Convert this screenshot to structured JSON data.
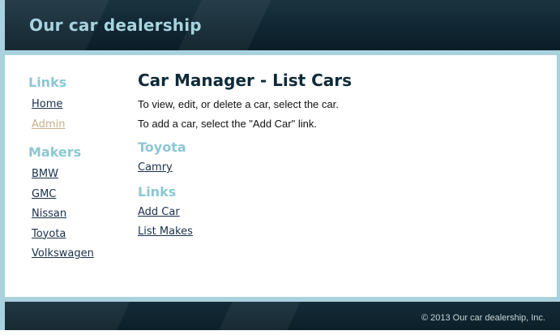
{
  "header": {
    "title": "Our car dealership"
  },
  "sidebar": {
    "links_heading": "Links",
    "links": [
      {
        "label": "Home",
        "active": false
      },
      {
        "label": "Admin",
        "active": true
      }
    ],
    "makers_heading": "Makers",
    "makers": [
      "BMW",
      "GMC",
      "Nissan",
      "Toyota",
      "Volkswagen"
    ]
  },
  "main": {
    "title": "Car Manager - List Cars",
    "instructions": [
      "To view, edit, or delete a car, select the car.",
      "To add a car, select the \"Add Car\" link."
    ],
    "make_heading": "Toyota",
    "cars": [
      "Camry"
    ],
    "links_heading": "Links",
    "links": [
      "Add Car",
      "List Makes"
    ]
  },
  "footer": {
    "copyright": "© 2013 Our car dealership, Inc."
  },
  "colors": {
    "header_bg": "#102632",
    "accent_heading": "#8cc7d3",
    "title_text": "#a7d3dd",
    "link": "#1b2f4a",
    "active_link": "#c9b08d",
    "frame": "#a9d2dc"
  }
}
